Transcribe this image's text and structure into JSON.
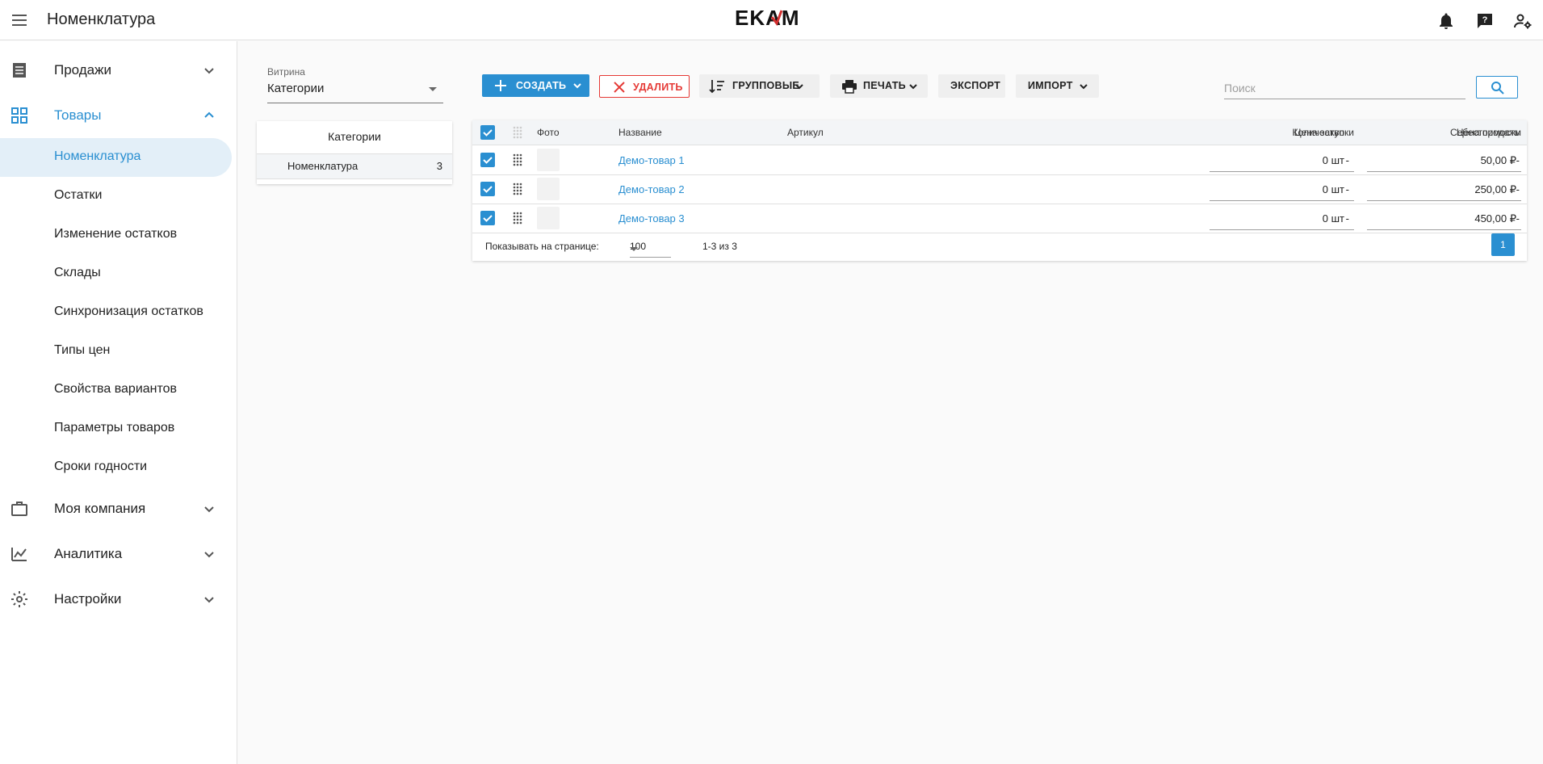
{
  "header": {
    "title": "Номенклатура",
    "logo_text": "EKAM",
    "icons": [
      "menu-icon",
      "bell-icon",
      "help-chat-icon",
      "user-settings-icon"
    ]
  },
  "sidebar": {
    "groups": [
      {
        "label": "Продажи",
        "icon": "receipt-icon",
        "expanded": false
      },
      {
        "label": "Товары",
        "icon": "grid-icon",
        "expanded": true,
        "active": true
      },
      {
        "label": "Моя компания",
        "icon": "briefcase-icon",
        "expanded": false
      },
      {
        "label": "Аналитика",
        "icon": "analytics-icon",
        "expanded": false
      },
      {
        "label": "Настройки",
        "icon": "gear-icon",
        "expanded": false
      }
    ],
    "goods_items": [
      {
        "label": "Номенклатура",
        "active": true
      },
      {
        "label": "Остатки"
      },
      {
        "label": "Изменение остатков"
      },
      {
        "label": "Склады"
      },
      {
        "label": "Синхронизация остатков"
      },
      {
        "label": "Типы цен"
      },
      {
        "label": "Свойства вариантов"
      },
      {
        "label": "Параметры товаров"
      },
      {
        "label": "Сроки годности"
      }
    ]
  },
  "showcase": {
    "label": "Витрина",
    "value": "Категории"
  },
  "categories": {
    "header": "Категории",
    "rows": [
      {
        "name": "Номенклатура",
        "count": "3"
      }
    ]
  },
  "toolbar": {
    "create": "СОЗДАТЬ",
    "delete": "УДАЛИТЬ",
    "group": "ГРУППОВЫЕ",
    "print": "ПЕЧАТЬ",
    "export": "ЭКСПОРТ",
    "import": "ИМПОРТ",
    "search_placeholder": "Поиск"
  },
  "table": {
    "columns": {
      "photo": "Фото",
      "name": "Название",
      "sku": "Артикул",
      "qty": "Количество",
      "cost": "Себестоимость",
      "purchase": "Цена закупки",
      "sale": "Цена продажи"
    },
    "rows": [
      {
        "name": "Демо-товар 1",
        "sku": "",
        "qty": "0 шт",
        "cost": "-",
        "purchase": "-",
        "sale": "50,00 ₽",
        "checked": true
      },
      {
        "name": "Демо-товар 2",
        "sku": "",
        "qty": "0 шт",
        "cost": "-",
        "purchase": "-",
        "sale": "250,00 ₽",
        "checked": true
      },
      {
        "name": "Демо-товар 3",
        "sku": "",
        "qty": "0 шт",
        "cost": "-",
        "purchase": "-",
        "sale": "450,00 ₽",
        "checked": true
      }
    ],
    "footer": {
      "per_page_label": "Показывать на странице:",
      "per_page_value": "100",
      "range": "1-3 из 3",
      "page": "1"
    }
  },
  "colors": {
    "accent": "#2a8fd1",
    "danger": "#e53935",
    "active_bg": "#e3eff8"
  }
}
